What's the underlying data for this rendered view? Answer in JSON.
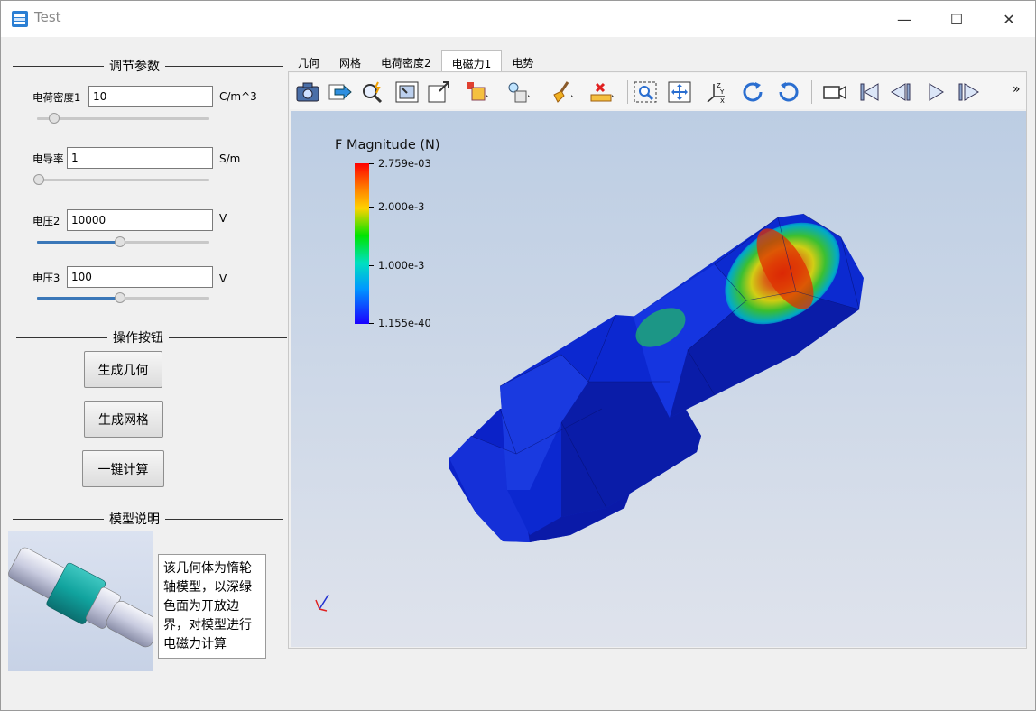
{
  "window": {
    "title": "Test"
  },
  "controls": {
    "minimize": "—",
    "maximize": "☐",
    "close": "✕"
  },
  "groups": {
    "params": "调节参数",
    "actions": "操作按钮",
    "model": "模型说明"
  },
  "params": [
    {
      "label": "电荷密度1",
      "value": "10",
      "unit": "C/m^3",
      "slider": 0.12
    },
    {
      "label": "电导率",
      "value": "1",
      "unit": "S/m",
      "slider": 0.0
    },
    {
      "label": "电压2",
      "value": "10000",
      "unit": "V",
      "slider": 0.47
    },
    {
      "label": "电压3",
      "value": "100",
      "unit": "V",
      "slider": 0.47
    }
  ],
  "buttons": {
    "geometry": "生成几何",
    "mesh": "生成网格",
    "compute": "一键计算"
  },
  "description": "该几何体为惰轮轴模型，以深绿色面为开放边界，对模型进行电磁力计算",
  "tabs": [
    "几何",
    "网格",
    "电荷密度2",
    "电磁力1",
    "电势"
  ],
  "active_tab": "电磁力1",
  "toolbar_more": "»",
  "legend": {
    "title": "F Magnitude (N)",
    "labels": [
      "2.759e-03",
      "2.000e-3",
      "1.000e-3",
      "1.155e-40"
    ]
  },
  "colors": {
    "accent": "#3a77b8",
    "bg_top": "#bccde3",
    "bg_bottom": "#dfe3ec"
  }
}
